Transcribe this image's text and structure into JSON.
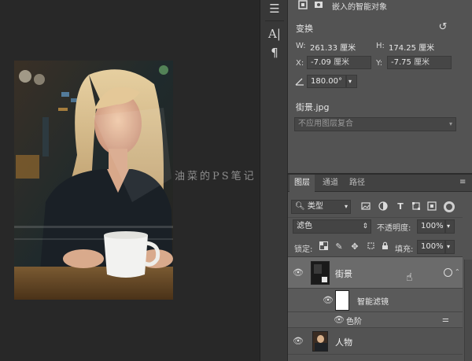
{
  "watermark": "油菜的PS笔记",
  "properties": {
    "header_label": "嵌入的智能对象",
    "section_title": "变换",
    "w_label": "W:",
    "w_value": "261.33 厘米",
    "h_label": "H:",
    "h_value": "174.25 厘米",
    "x_label": "X:",
    "x_value": "-7.09",
    "x_unit": "厘米",
    "y_label": "Y:",
    "y_value": "-7.75",
    "y_unit": "厘米",
    "angle_value": "180.00°",
    "filename": "街景.jpg",
    "comp_placeholder": "不应用图层复合"
  },
  "layers_panel": {
    "tabs": [
      "图层",
      "通道",
      "路径"
    ],
    "filter_kind": "类型",
    "blend_mode": "滤色",
    "opacity_label": "不透明度:",
    "opacity_value": "100%",
    "lock_label": "锁定:",
    "fill_label": "填充:",
    "fill_value": "100%",
    "layers": {
      "street": "街景",
      "smart_filters": "智能滤镜",
      "levels": "色阶",
      "person": "人物"
    }
  },
  "colors": {
    "panel_bg": "#535353",
    "canvas_bg": "#282828",
    "selected_layer_bg": "#6b6b6b"
  }
}
